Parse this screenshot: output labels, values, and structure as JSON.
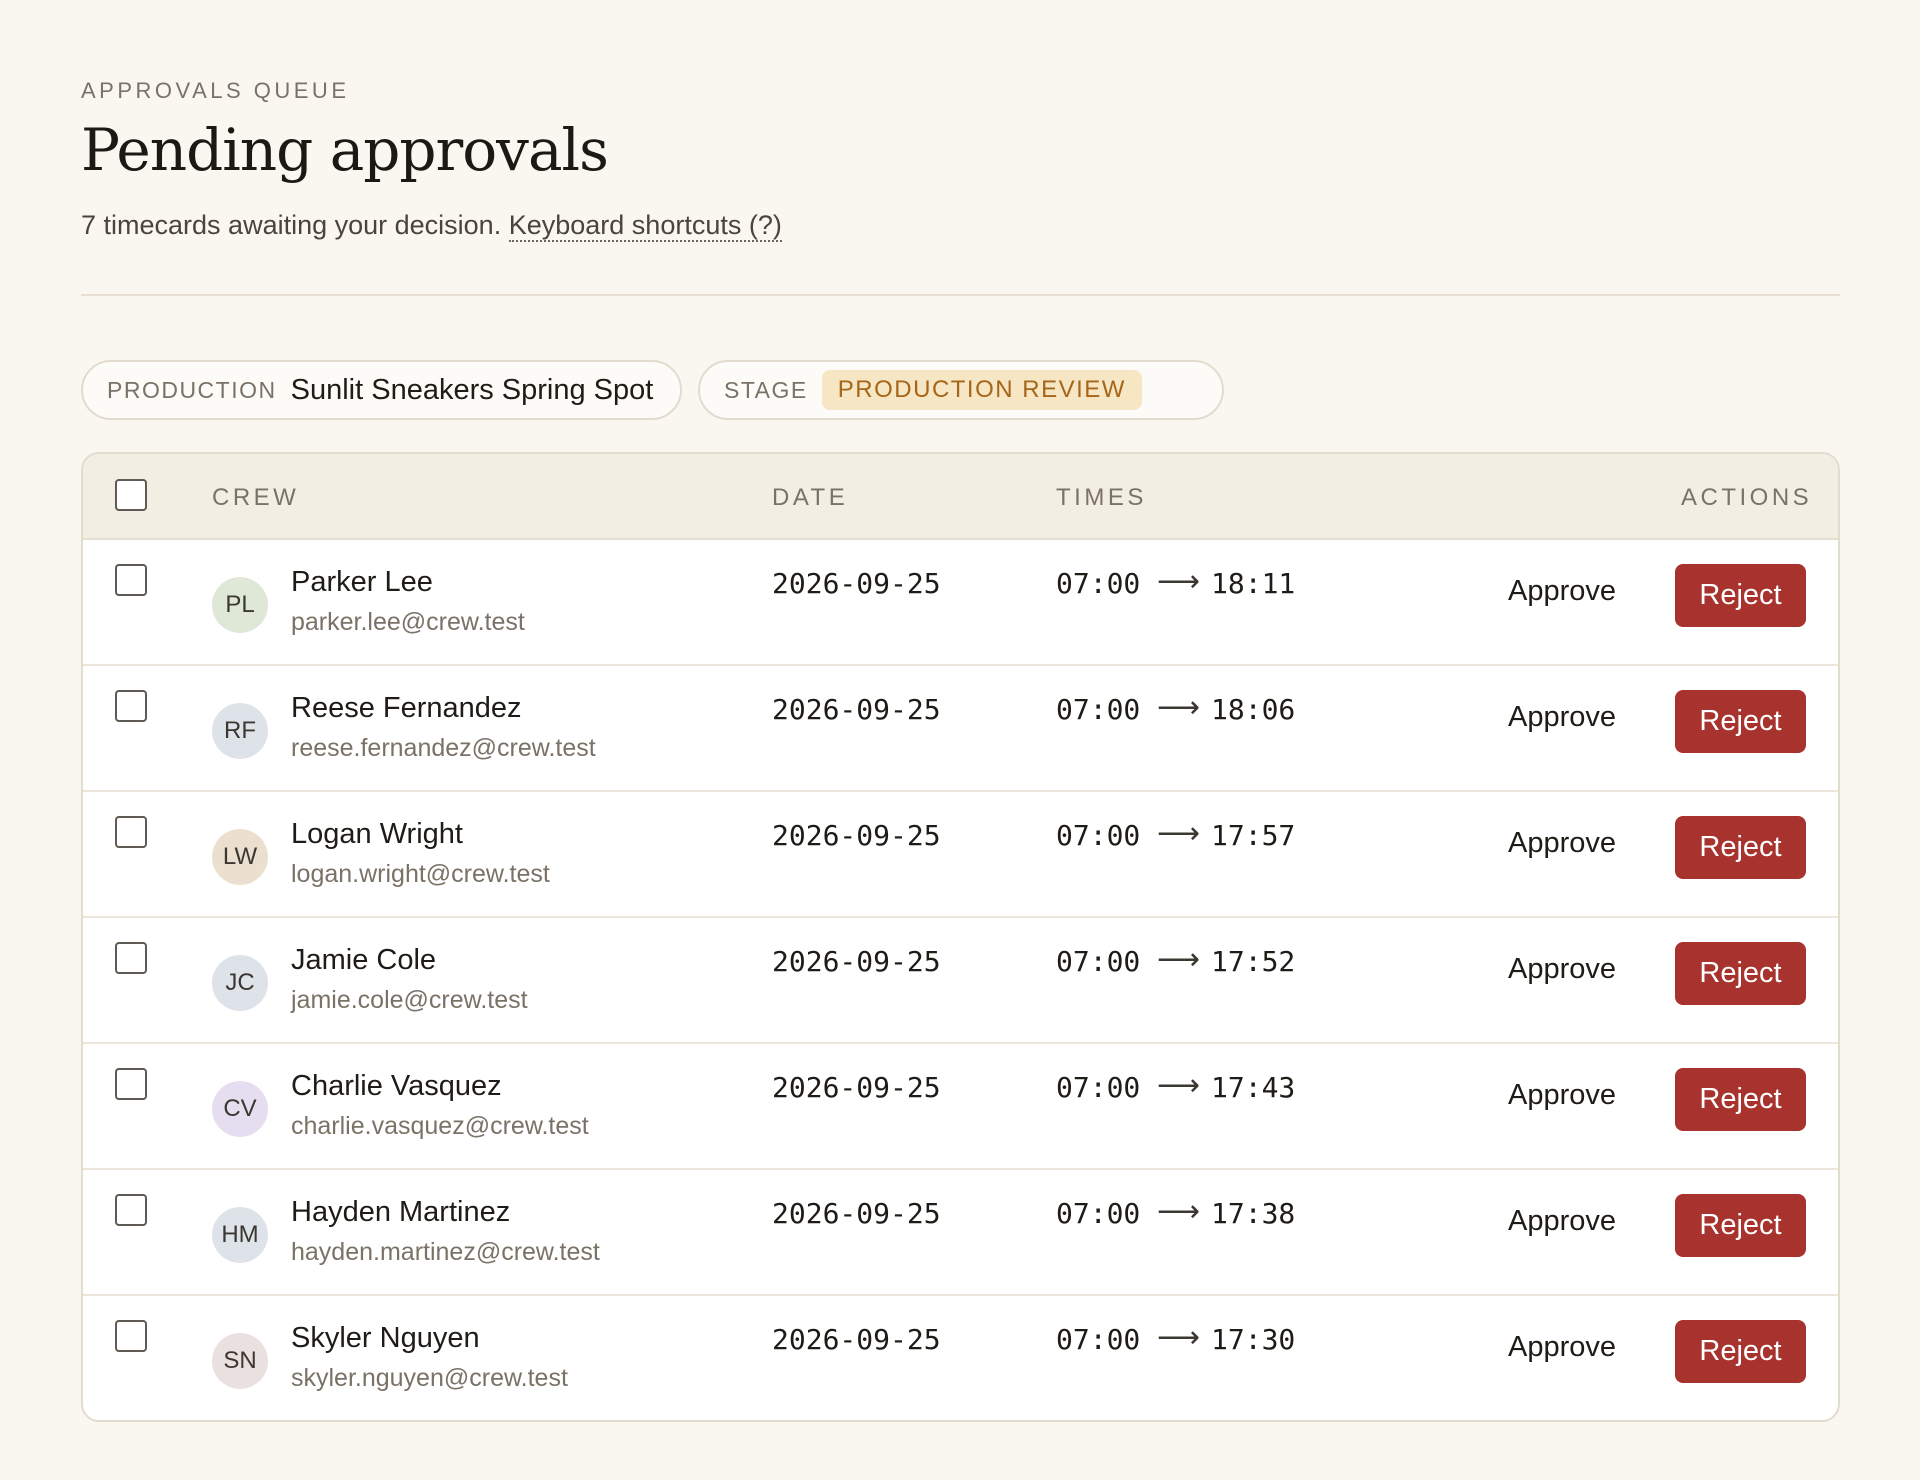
{
  "header": {
    "eyebrow": "APPROVALS QUEUE",
    "title": "Pending approvals",
    "subtitle": "7 timecards awaiting your decision.",
    "shortcuts_link": "Keyboard shortcuts (?)"
  },
  "filters": {
    "production_label": "PRODUCTION",
    "production_value": "Sunlit Sneakers Spring Spot",
    "stage_label": "STAGE",
    "stage_value": "PRODUCTION REVIEW"
  },
  "colors": {
    "accent_reject": "#a8322d",
    "stage_badge_bg": "#f7e6c4",
    "stage_badge_text": "#a5661a",
    "page_bg": "#faf7f1"
  },
  "table": {
    "columns": {
      "crew": "CREW",
      "date": "DATE",
      "times": "TIMES",
      "actions": "ACTIONS"
    },
    "arrow_glyph": "⟶",
    "approve_label": "Approve",
    "reject_label": "Reject",
    "rows": [
      {
        "initials": "PL",
        "avatar_color": "#dfe8d6",
        "name": "Parker Lee",
        "email": "parker.lee@crew.test",
        "date": "2026-09-25",
        "start": "07:00",
        "end": "18:11"
      },
      {
        "initials": "RF",
        "avatar_color": "#dde3e8",
        "name": "Reese Fernandez",
        "email": "reese.fernandez@crew.test",
        "date": "2026-09-25",
        "start": "07:00",
        "end": "18:06"
      },
      {
        "initials": "LW",
        "avatar_color": "#ebe0cf",
        "name": "Logan Wright",
        "email": "logan.wright@crew.test",
        "date": "2026-09-25",
        "start": "07:00",
        "end": "17:57"
      },
      {
        "initials": "JC",
        "avatar_color": "#dde3e8",
        "name": "Jamie Cole",
        "email": "jamie.cole@crew.test",
        "date": "2026-09-25",
        "start": "07:00",
        "end": "17:52"
      },
      {
        "initials": "CV",
        "avatar_color": "#e5def0",
        "name": "Charlie Vasquez",
        "email": "charlie.vasquez@crew.test",
        "date": "2026-09-25",
        "start": "07:00",
        "end": "17:43"
      },
      {
        "initials": "HM",
        "avatar_color": "#dde3e8",
        "name": "Hayden Martinez",
        "email": "hayden.martinez@crew.test",
        "date": "2026-09-25",
        "start": "07:00",
        "end": "17:38"
      },
      {
        "initials": "SN",
        "avatar_color": "#ebe0e0",
        "name": "Skyler Nguyen",
        "email": "skyler.nguyen@crew.test",
        "date": "2026-09-25",
        "start": "07:00",
        "end": "17:30"
      }
    ]
  }
}
